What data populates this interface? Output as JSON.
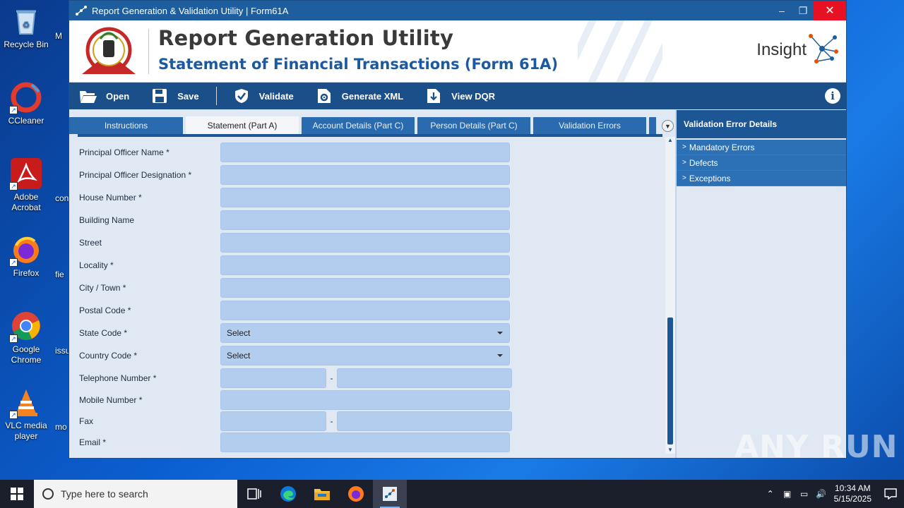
{
  "desktop": {
    "icons": [
      {
        "label": "Recycle Bin",
        "icon": "recycle-bin-icon"
      },
      {
        "label": "CCleaner",
        "icon": "ccleaner-icon"
      },
      {
        "label": "Adobe Acrobat",
        "icon": "acrobat-icon"
      },
      {
        "label": "Firefox",
        "icon": "firefox-icon"
      },
      {
        "label": "Google Chrome",
        "icon": "chrome-icon"
      },
      {
        "label": "VLC media player",
        "icon": "vlc-icon"
      }
    ],
    "partial_labels": [
      "M",
      "con",
      "fie",
      "issu",
      "mo"
    ]
  },
  "window": {
    "title": "Report Generation & Validation Utility | Form61A",
    "controls": {
      "minimize": "–",
      "restore": "❐",
      "close": "✕"
    }
  },
  "banner": {
    "title": "Report Generation Utility",
    "subtitle": "Statement of Financial Transactions (Form 61A)",
    "emblem_text": "INCOME TAX DEPARTMENT",
    "brand": "Insight"
  },
  "toolbar": {
    "open": "Open",
    "save": "Save",
    "validate": "Validate",
    "generate_xml": "Generate XML",
    "view_dqr": "View DQR",
    "info": "i"
  },
  "tabs": [
    {
      "label": "Instructions",
      "active": false
    },
    {
      "label": "Statement (Part A)",
      "active": true
    },
    {
      "label": "Account Details (Part C)",
      "active": false
    },
    {
      "label": "Person Details (Part C)",
      "active": false
    },
    {
      "label": "Validation Errors",
      "active": false
    }
  ],
  "form": {
    "principal_officer_name": "Principal Officer Name *",
    "principal_officer_designation": "Principal Officer Designation *",
    "house_number": "House Number *",
    "building_name": "Building Name",
    "street": "Street",
    "locality": "Locality *",
    "city_town": "City / Town *",
    "postal_code": "Postal Code *",
    "state_code": "State Code *",
    "state_code_value": "Select",
    "country_code": "Country Code *",
    "country_code_value": "Select",
    "telephone_number": "Telephone Number *",
    "mobile_number": "Mobile Number *",
    "fax": "Fax",
    "email": "Email *",
    "dash": "-"
  },
  "validation_panel": {
    "header": "Validation Error Details",
    "items": [
      "Mandatory Errors",
      "Defects",
      "Exceptions"
    ]
  },
  "watermark": "ANY RUN",
  "taskbar": {
    "search_placeholder": "Type here to search",
    "time": "10:34 AM",
    "date": "5/15/2025"
  },
  "colors": {
    "titlebar": "#1f5e9e",
    "toolbar": "#1a4f8a",
    "tab": "#2a6bb0",
    "input": "#b3cdef",
    "panel_header": "#1d5694"
  }
}
